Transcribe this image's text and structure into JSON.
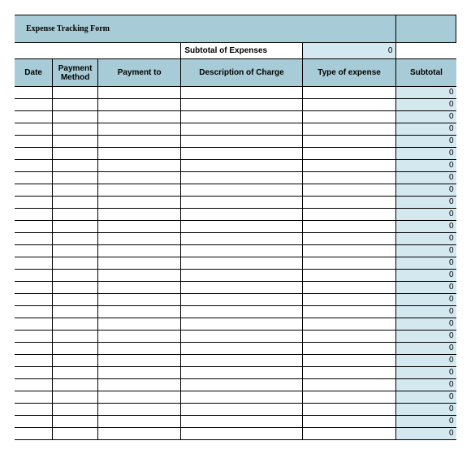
{
  "title": "Expense Tracking Form",
  "subtotal_label": "Subtotal of Expenses",
  "subtotal_value": "0",
  "headers": {
    "date": "Date",
    "method": "Payment Method",
    "payto": "Payment to",
    "desc": "Description of  Charge",
    "type": "Type of expense",
    "subtotal": "Subtotal"
  },
  "rows": [
    {
      "date": "",
      "method": "",
      "payto": "",
      "desc": "",
      "type": "",
      "subtotal": "0"
    },
    {
      "date": "",
      "method": "",
      "payto": "",
      "desc": "",
      "type": "",
      "subtotal": "0"
    },
    {
      "date": "",
      "method": "",
      "payto": "",
      "desc": "",
      "type": "",
      "subtotal": "0"
    },
    {
      "date": "",
      "method": "",
      "payto": "",
      "desc": "",
      "type": "",
      "subtotal": "0"
    },
    {
      "date": "",
      "method": "",
      "payto": "",
      "desc": "",
      "type": "",
      "subtotal": "0"
    },
    {
      "date": "",
      "method": "",
      "payto": "",
      "desc": "",
      "type": "",
      "subtotal": "0"
    },
    {
      "date": "",
      "method": "",
      "payto": "",
      "desc": "",
      "type": "",
      "subtotal": "0"
    },
    {
      "date": "",
      "method": "",
      "payto": "",
      "desc": "",
      "type": "",
      "subtotal": "0"
    },
    {
      "date": "",
      "method": "",
      "payto": "",
      "desc": "",
      "type": "",
      "subtotal": "0"
    },
    {
      "date": "",
      "method": "",
      "payto": "",
      "desc": "",
      "type": "",
      "subtotal": "0"
    },
    {
      "date": "",
      "method": "",
      "payto": "",
      "desc": "",
      "type": "",
      "subtotal": "0"
    },
    {
      "date": "",
      "method": "",
      "payto": "",
      "desc": "",
      "type": "",
      "subtotal": "0"
    },
    {
      "date": "",
      "method": "",
      "payto": "",
      "desc": "",
      "type": "",
      "subtotal": "0"
    },
    {
      "date": "",
      "method": "",
      "payto": "",
      "desc": "",
      "type": "",
      "subtotal": "0"
    },
    {
      "date": "",
      "method": "",
      "payto": "",
      "desc": "",
      "type": "",
      "subtotal": "0"
    },
    {
      "date": "",
      "method": "",
      "payto": "",
      "desc": "",
      "type": "",
      "subtotal": "0"
    },
    {
      "date": "",
      "method": "",
      "payto": "",
      "desc": "",
      "type": "",
      "subtotal": "0"
    },
    {
      "date": "",
      "method": "",
      "payto": "",
      "desc": "",
      "type": "",
      "subtotal": "0"
    },
    {
      "date": "",
      "method": "",
      "payto": "",
      "desc": "",
      "type": "",
      "subtotal": "0"
    },
    {
      "date": "",
      "method": "",
      "payto": "",
      "desc": "",
      "type": "",
      "subtotal": "0"
    },
    {
      "date": "",
      "method": "",
      "payto": "",
      "desc": "",
      "type": "",
      "subtotal": "0"
    },
    {
      "date": "",
      "method": "",
      "payto": "",
      "desc": "",
      "type": "",
      "subtotal": "0"
    },
    {
      "date": "",
      "method": "",
      "payto": "",
      "desc": "",
      "type": "",
      "subtotal": "0"
    },
    {
      "date": "",
      "method": "",
      "payto": "",
      "desc": "",
      "type": "",
      "subtotal": "0"
    },
    {
      "date": "",
      "method": "",
      "payto": "",
      "desc": "",
      "type": "",
      "subtotal": "0"
    },
    {
      "date": "",
      "method": "",
      "payto": "",
      "desc": "",
      "type": "",
      "subtotal": "0"
    },
    {
      "date": "",
      "method": "",
      "payto": "",
      "desc": "",
      "type": "",
      "subtotal": "0"
    },
    {
      "date": "",
      "method": "",
      "payto": "",
      "desc": "",
      "type": "",
      "subtotal": "0"
    },
    {
      "date": "",
      "method": "",
      "payto": "",
      "desc": "",
      "type": "",
      "subtotal": "0"
    }
  ]
}
